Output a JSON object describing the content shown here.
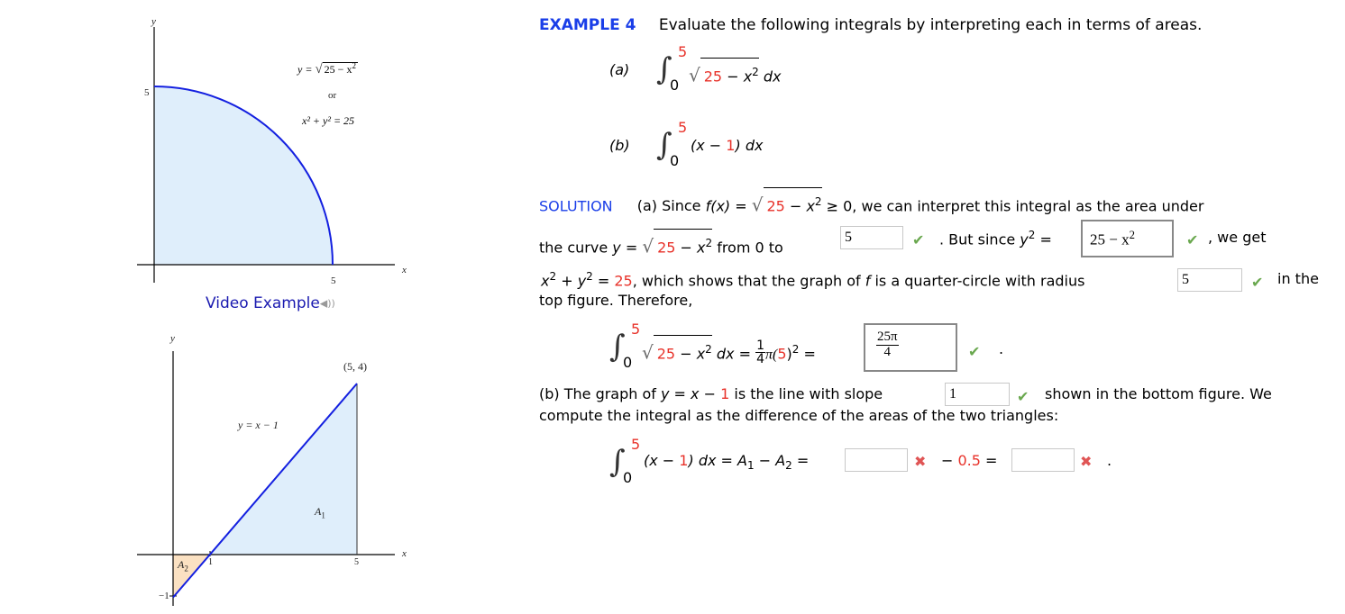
{
  "header": {
    "example_label": "EXAMPLE 4",
    "instruction": "Evaluate the following integrals by interpreting each in terms of areas."
  },
  "problems": {
    "a": {
      "label": "(a)",
      "lower": "0",
      "upper": "5",
      "radicand_const": "25",
      "radicand_rest": " − x",
      "exp": "2",
      "dx": " dx"
    },
    "b": {
      "label": "(b)",
      "lower": "0",
      "upper": "5",
      "open": "(x − ",
      "const": "1",
      "close": ") dx"
    }
  },
  "solution": {
    "label": "SOLUTION",
    "line1_pre": "(a) Since ",
    "line1_fx": "f(x) = ",
    "line1_post": " ≥ 0,  we can interpret this integral as the area under",
    "line2_pre": "the curve  ",
    "line2_y": "y = ",
    "line2_mid": " from 0 to",
    "line2_but": ". But since ",
    "line2_y2": "y",
    "line2_eq": " = ",
    "line2_post": ",  we get",
    "line3_pre_x": "x",
    "line3_plus": " + ",
    "line3_y": "y",
    "line3_eq": " = ",
    "line3_25": "25",
    "line3_post": ",  which shows that the graph of ",
    "line3_f": "f",
    "line3_post2": " is a quarter-circle with radius",
    "line3_end": "in the",
    "line4": "top figure. Therefore,",
    "eq_a_mid": " dx = ",
    "eq_a_frac_num": "1",
    "eq_a_frac_den": "4",
    "eq_a_pi": "π(",
    "eq_a_5": "5",
    "eq_a_close": ")",
    "eq_a_eq": " =",
    "eq_a_period": ".",
    "b_line1_pre": "(b) The graph of  ",
    "b_line1_y": "y = x − ",
    "b_line1_1": "1",
    "b_line1_mid": "  is the line with slope",
    "b_line1_post": "shown in the bottom figure. We",
    "b_line2": "compute the integral as the difference of the areas of the two triangles:",
    "eq_b_open": "(x − ",
    "eq_b_1": "1",
    "eq_b_rest": ") dx = A",
    "eq_b_sub1": "1",
    "eq_b_minus": " − A",
    "eq_b_sub2": "2",
    "eq_b_eq": " =",
    "eq_b_minus05": "− ",
    "eq_b_05": "0.5",
    "eq_b_eq2": " =",
    "eq_b_period": "."
  },
  "inputs": {
    "from_0_to": {
      "value": "5",
      "status": "correct"
    },
    "y_squared": {
      "value_main": "25 − x",
      "value_exp": "2",
      "status": "correct"
    },
    "radius": {
      "value": "5",
      "status": "correct"
    },
    "area_a": {
      "num": "25π",
      "den": "4",
      "status": "correct"
    },
    "slope": {
      "value": "1",
      "status": "correct"
    },
    "a1": {
      "value": "",
      "status": "incorrect"
    },
    "result_b": {
      "value": "",
      "status": "incorrect"
    }
  },
  "icons": {
    "check": "✔",
    "cross": "✖",
    "speaker": "🔊"
  },
  "video_example": {
    "label": "Video Example"
  },
  "figure_top": {
    "y_axis": "y",
    "x_axis": "x",
    "y_tick": "5",
    "x_tick": "5",
    "eq1_pre": "y = ",
    "eq1_rad": "25 − x",
    "eq1_exp": "2",
    "or": "or",
    "eq2": "x² + y² = 25",
    "curve_color": "#1420e0",
    "fill_color": "#dfeefb",
    "radius": 5
  },
  "figure_bottom": {
    "y_axis": "y",
    "x_axis": "x",
    "point_label": "(5, 4)",
    "line_label": "y = x − 1",
    "a1_label": "A",
    "a1_sub": "1",
    "a2_label": "A",
    "a2_sub": "2",
    "x_tick_1": "1",
    "x_tick_5": "5",
    "y_tick_neg1": "−1",
    "line_color": "#1420e0",
    "a1_fill": "#dfeefb",
    "a2_fill": "#fbe1c2",
    "slope": 1,
    "intercept": -1
  }
}
